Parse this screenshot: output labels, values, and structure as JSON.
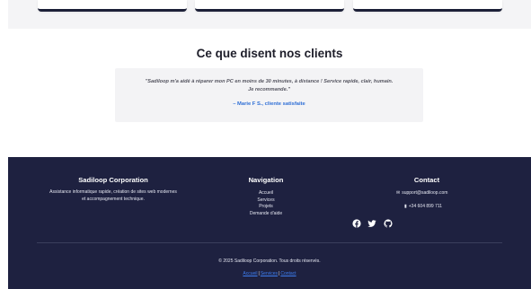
{
  "testimonials": {
    "title": "Ce que disent nos clients",
    "quote_line1": "\"Sadiloop m'a aidé à réparer mon PC en moins de 30 minutes, à distance ! Service rapide, clair, humain.",
    "quote_line2": "Je recommande.\"",
    "author": "– Marie F S., cliente satisfaite"
  },
  "footer": {
    "company": {
      "title": "Sadiloop Corporation",
      "desc_line1": "Assistance informatique rapide, création de sites web modernes",
      "desc_line2": "et accompagnement technique."
    },
    "navigation": {
      "title": "Navigation",
      "links": [
        "Accueil",
        "Services",
        "Projets",
        "Demande d'aide"
      ]
    },
    "contact": {
      "title": "Contact",
      "email": "support@sadiloop.com",
      "phone": "+34 604 899 711",
      "socials": [
        "facebook-icon",
        "twitter-icon",
        "github-icon"
      ]
    },
    "copyright": "© 2025 Sadiloop Corporation. Tous droits réservés.",
    "bottom_links": [
      "Accueil",
      "Services",
      "Contact"
    ],
    "bottom_separator": "|"
  },
  "colors": {
    "footer_bg": "#1e2140",
    "accent_link": "#2f6fd6"
  }
}
